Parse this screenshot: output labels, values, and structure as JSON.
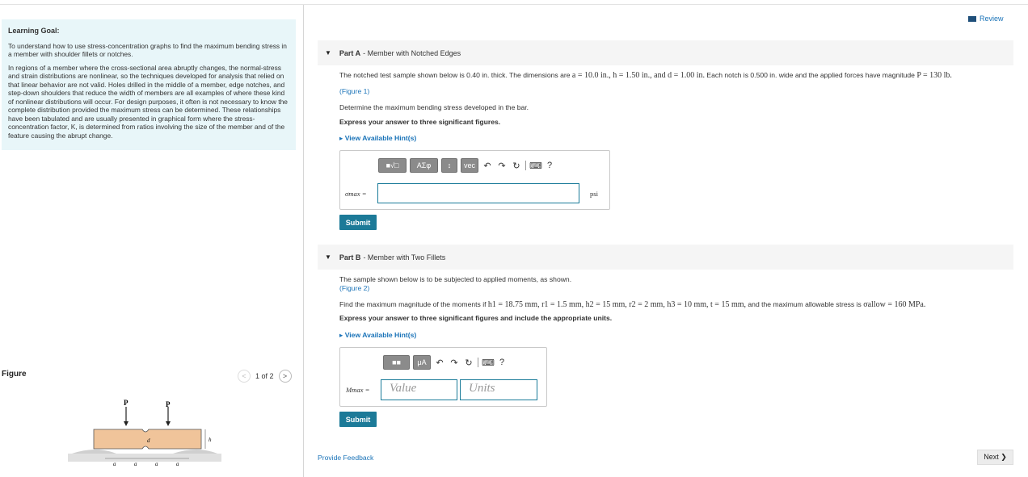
{
  "learning_goal": {
    "title": "Learning Goal:",
    "p1": "To understand how to use stress-concentration graphs to find the maximum bending stress in a member with shoulder fillets or notches.",
    "p2": "In regions of a member where the cross-sectional area abruptly changes, the normal-stress and strain distributions are nonlinear, so the techniques developed for analysis that relied on that linear behavior are not valid. Holes drilled in the middle of a member, edge notches, and step-down shoulders that reduce the width of members are all examples of where these kind of nonlinear distributions will occur. For design purposes, it often is not necessary to know the complete distribution provided the maximum stress can be determined. These relationships have been tabulated and are usually presented in graphical form where the stress-concentration factor, K, is determined from ratios involving the size of the member and of the feature causing the abrupt change."
  },
  "figure": {
    "label": "Figure",
    "pager": "1 of 2",
    "labels": {
      "p": "P",
      "d": "d",
      "h": "h",
      "a": "a"
    }
  },
  "review": "Review",
  "part_a": {
    "label": "Part A",
    "title": " - Member with Notched Edges",
    "line1_pre": "The notched test sample shown below is 0.40 in. thick. The dimensions are ",
    "line1_math": "a = 10.0 in., h = 1.50 in., and d = 1.00 in.",
    "line1_mid": " Each notch is 0.500 in. wide and the applied forces have magnitude ",
    "line1_math2": "P = 130 lb.",
    "figure_link": "(Figure 1)",
    "question": "Determine the maximum bending stress developed in the bar.",
    "instruction": "Express your answer to three significant figures.",
    "hints": "View Available Hint(s)",
    "toolbar": [
      "■√□",
      "AΣφ",
      "↕",
      "vec"
    ],
    "var_label": "σmax =",
    "unit": "psi",
    "input_value": "",
    "submit": "Submit"
  },
  "part_b": {
    "label": "Part B",
    "title": " - Member with Two Fillets",
    "line1": "The sample shown below is to be subjected to applied moments, as shown.",
    "figure_link": "(Figure 2)",
    "question_pre": "Find the maximum magnitude of the moments if ",
    "question_math": "h1 = 18.75 mm, r1 = 1.5 mm, h2 = 15 mm, r2 = 2 mm, h3 = 10 mm, t = 15 mm,",
    "question_mid": " and the maximum allowable stress is ",
    "question_math2": "σallow = 160 MPa.",
    "instruction": "Express your answer to three significant figures and include the appropriate units.",
    "hints": "View Available Hint(s)",
    "var_label": "Mmax =",
    "value_placeholder": "Value",
    "units_placeholder": "Units",
    "submit": "Submit"
  },
  "feedback": "Provide Feedback",
  "next": "Next ❯"
}
